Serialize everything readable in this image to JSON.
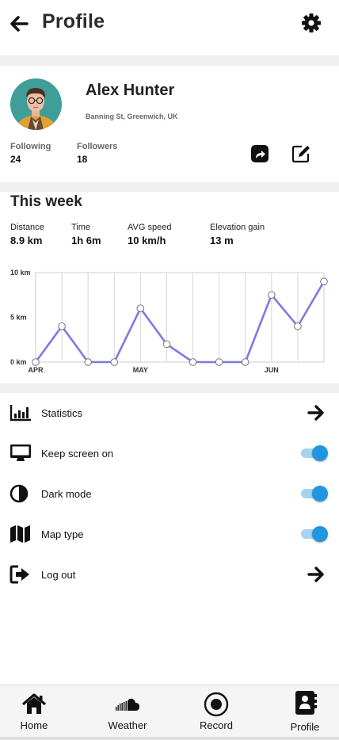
{
  "header": {
    "title": "Profile",
    "back_icon": "arrow-left-icon",
    "settings_icon": "gear-icon"
  },
  "profile": {
    "name": "Alex Hunter",
    "location": "Banning St, Greenwich, UK",
    "following_label": "Following",
    "following_value": "24",
    "followers_label": "Followers",
    "followers_value": "18",
    "share_icon": "share-icon",
    "edit_icon": "edit-icon"
  },
  "week": {
    "title": "This week",
    "metrics": [
      {
        "label": "Distance",
        "value": "8.9 km"
      },
      {
        "label": "Time",
        "value": "1h 6m"
      },
      {
        "label": "AVG speed",
        "value": "10 km/h"
      },
      {
        "label": "Elevation gain",
        "value": "13 m"
      }
    ]
  },
  "chart_data": {
    "type": "line",
    "title": "",
    "ylabel": "",
    "xlabel": "",
    "ylim": [
      0,
      10
    ],
    "y_ticks": [
      "10 km",
      "5 km",
      "0 km"
    ],
    "y_tick_values": [
      10,
      5,
      0
    ],
    "x_ticks": [
      "APR",
      "MAY",
      "JUN"
    ],
    "x_tick_index": [
      0,
      4,
      9
    ],
    "x": [
      0,
      1,
      2,
      3,
      4,
      5,
      6,
      7,
      8,
      9,
      10,
      11
    ],
    "values": [
      0,
      4,
      0,
      0,
      6,
      2,
      0,
      0,
      0,
      7.5,
      4,
      9
    ],
    "grid": true,
    "line_color": "#7b7be6"
  },
  "menu": {
    "items": [
      {
        "label": "Statistics",
        "icon": "bar-chart-icon",
        "control": "arrow"
      },
      {
        "label": "Keep screen on",
        "icon": "monitor-icon",
        "control": "toggle",
        "on": true
      },
      {
        "label": "Dark mode",
        "icon": "contrast-icon",
        "control": "toggle",
        "on": true
      },
      {
        "label": "Map type",
        "icon": "map-icon",
        "control": "toggle",
        "on": true
      },
      {
        "label": "Log out",
        "icon": "logout-icon",
        "control": "arrow"
      }
    ],
    "toggle_color": "#2196e0"
  },
  "nav": {
    "items": [
      {
        "label": "Home",
        "icon": "home-icon"
      },
      {
        "label": "Weather",
        "icon": "cloud-icon"
      },
      {
        "label": "Record",
        "icon": "record-icon"
      },
      {
        "label": "Profile",
        "icon": "contact-book-icon",
        "active": true
      }
    ]
  }
}
